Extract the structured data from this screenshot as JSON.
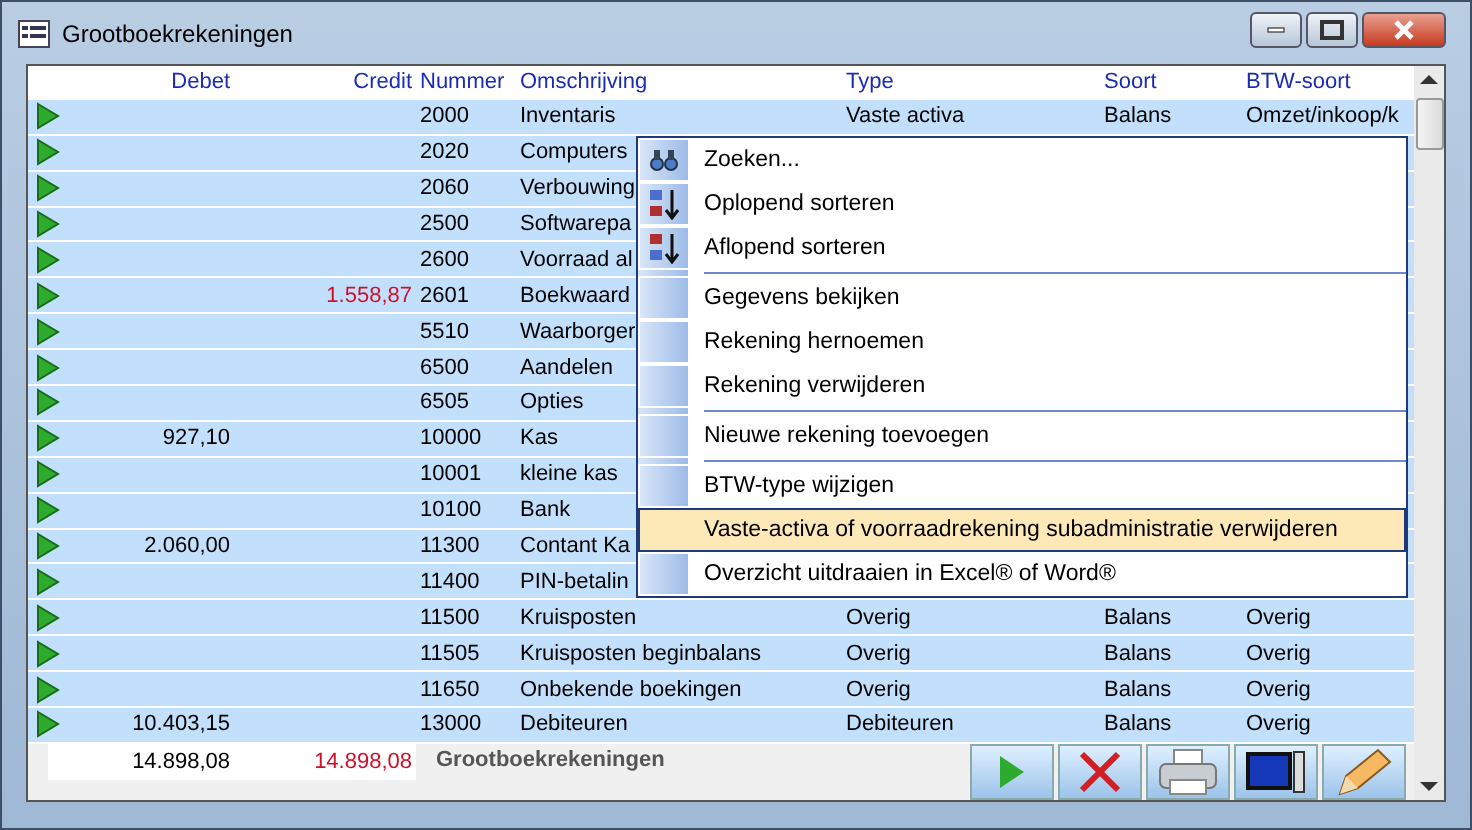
{
  "window": {
    "title": "Grootboekrekeningen"
  },
  "table": {
    "columns": [
      "Debet",
      "Credit",
      "Nummer",
      "Omschrijving",
      "Type",
      "Soort",
      "BTW-soort"
    ],
    "rows": [
      {
        "debet": "",
        "credit": "",
        "nummer": "2000",
        "omschrijving": "Inventaris",
        "type": "Vaste activa",
        "soort": "Balans",
        "btw": "Omzet/inkoop/k"
      },
      {
        "debet": "",
        "credit": "",
        "nummer": "2020",
        "omschrijving": "Computers",
        "type": "",
        "soort": "",
        "btw": ""
      },
      {
        "debet": "",
        "credit": "",
        "nummer": "2060",
        "omschrijving": "Verbouwing",
        "type": "",
        "soort": "",
        "btw": ""
      },
      {
        "debet": "",
        "credit": "",
        "nummer": "2500",
        "omschrijving": "Softwarepa",
        "type": "",
        "soort": "",
        "btw": ""
      },
      {
        "debet": "",
        "credit": "",
        "nummer": "2600",
        "omschrijving": "Voorraad al",
        "type": "",
        "soort": "",
        "btw": ""
      },
      {
        "debet": "",
        "credit": "1.558,87",
        "nummer": "2601",
        "omschrijving": "Boekwaard",
        "type": "",
        "soort": "",
        "btw": ""
      },
      {
        "debet": "",
        "credit": "",
        "nummer": "5510",
        "omschrijving": "Waarborger",
        "type": "",
        "soort": "",
        "btw": ""
      },
      {
        "debet": "",
        "credit": "",
        "nummer": "6500",
        "omschrijving": "Aandelen",
        "type": "",
        "soort": "",
        "btw": ""
      },
      {
        "debet": "",
        "credit": "",
        "nummer": "6505",
        "omschrijving": "Opties",
        "type": "",
        "soort": "",
        "btw": ""
      },
      {
        "debet": "927,10",
        "credit": "",
        "nummer": "10000",
        "omschrijving": "Kas",
        "type": "",
        "soort": "",
        "btw": ""
      },
      {
        "debet": "",
        "credit": "",
        "nummer": "10001",
        "omschrijving": "kleine kas",
        "type": "",
        "soort": "",
        "btw": ""
      },
      {
        "debet": "",
        "credit": "",
        "nummer": "10100",
        "omschrijving": "Bank",
        "type": "",
        "soort": "",
        "btw": ""
      },
      {
        "debet": "2.060,00",
        "credit": "",
        "nummer": "11300",
        "omschrijving": "Contant Ka",
        "type": "",
        "soort": "",
        "btw": ""
      },
      {
        "debet": "",
        "credit": "",
        "nummer": "11400",
        "omschrijving": "PIN-betalin",
        "type": "",
        "soort": "",
        "btw": ""
      },
      {
        "debet": "",
        "credit": "",
        "nummer": "11500",
        "omschrijving": "Kruisposten",
        "type": "Overig",
        "soort": "Balans",
        "btw": "Overig"
      },
      {
        "debet": "",
        "credit": "",
        "nummer": "11505",
        "omschrijving": "Kruisposten beginbalans",
        "type": "Overig",
        "soort": "Balans",
        "btw": "Overig"
      },
      {
        "debet": "",
        "credit": "",
        "nummer": "11650",
        "omschrijving": "Onbekende boekingen",
        "type": "Overig",
        "soort": "Balans",
        "btw": "Overig"
      },
      {
        "debet": "10.403,15",
        "credit": "",
        "nummer": "13000",
        "omschrijving": "Debiteuren",
        "type": "Debiteuren",
        "soort": "Balans",
        "btw": "Overig"
      }
    ],
    "totals": {
      "debet": "14.898,08",
      "credit": "14.898,08",
      "label": "Grootboekrekeningen"
    }
  },
  "toolbar": [
    {
      "kind": "play"
    },
    {
      "kind": "delete"
    },
    {
      "kind": "print"
    },
    {
      "kind": "screen"
    },
    {
      "kind": "edit"
    }
  ],
  "context_menu": {
    "items": [
      {
        "label": "Zoeken...",
        "kind": "search",
        "separator_after": false,
        "selected": false
      },
      {
        "label": "Oplopend sorteren",
        "kind": "sort-ascending",
        "separator_after": false,
        "selected": false
      },
      {
        "label": "Aflopend sorteren",
        "kind": "sort-descending",
        "separator_after": true,
        "selected": false
      },
      {
        "label": "Gegevens bekijken",
        "separator_after": false,
        "selected": false
      },
      {
        "label": "Rekening hernoemen",
        "separator_after": false,
        "selected": false
      },
      {
        "label": "Rekening verwijderen",
        "separator_after": true,
        "selected": false
      },
      {
        "label": "Nieuwe rekening toevoegen",
        "separator_after": true,
        "selected": false
      },
      {
        "label": "BTW-type wijzigen",
        "separator_after": false,
        "selected": false
      },
      {
        "label": "Vaste-activa of voorraadrekening subadministratie verwijderen",
        "separator_after": false,
        "selected": true
      },
      {
        "label": "Overzicht uitdraaien in Excel® of Word®",
        "separator_after": false,
        "selected": false
      }
    ]
  }
}
